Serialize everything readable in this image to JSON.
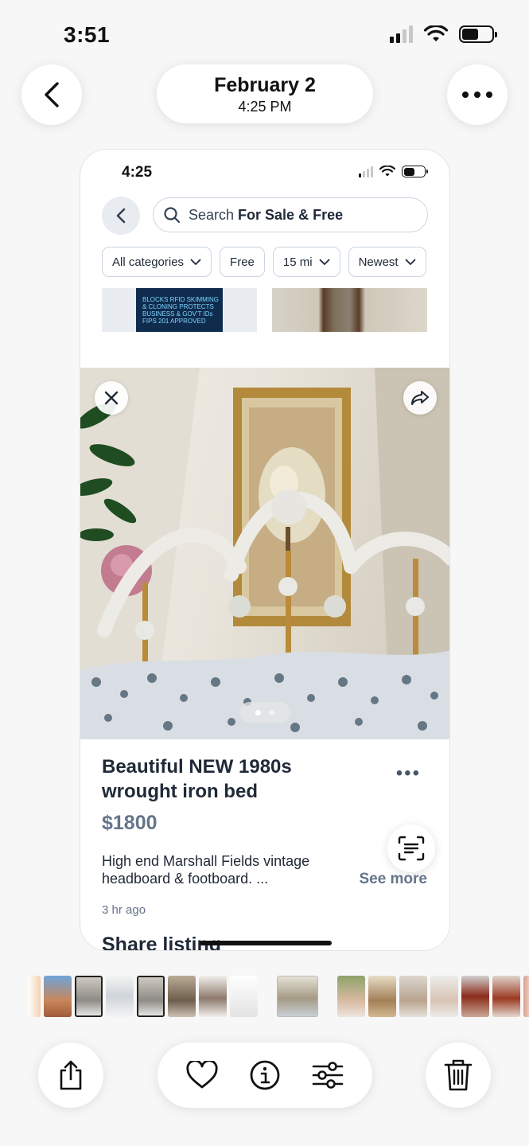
{
  "os_status": {
    "time": "3:51"
  },
  "header": {
    "date": "February 2",
    "time": "4:25 PM"
  },
  "screenshot": {
    "status_time": "4:25",
    "search": {
      "prefix": "Search ",
      "scope": "For Sale & Free"
    },
    "filters": [
      {
        "label": "All categories",
        "dropdown": true
      },
      {
        "label": "Free",
        "dropdown": false
      },
      {
        "label": "15 mi",
        "dropdown": true
      },
      {
        "label": "Newest",
        "dropdown": true
      }
    ],
    "thumb_card_text": "BLOCKS RFID SKIMMING & CLONING PROTECTS BUSINESS & GOV'T IDs FIPS 201 APPROVED",
    "listing": {
      "title": "Beautiful NEW 1980s wrought iron bed",
      "price": "$1800",
      "description": "High end Marshall Fields  vintage headboard & footboard. ...",
      "see_more": "See more",
      "posted": "3 hr ago",
      "share_heading": "Share listing"
    },
    "image_pager": {
      "count": 2,
      "active": 0
    }
  },
  "colors": {
    "accent": "#64748b",
    "text": "#1f2937",
    "chip_border": "#cbd5e1"
  },
  "icons": {
    "back": "chevron-left-icon",
    "more": "ellipsis-icon",
    "share": "share-icon",
    "favorite": "heart-icon",
    "info": "info-icon",
    "adjust": "sliders-icon",
    "delete": "trash-icon"
  }
}
